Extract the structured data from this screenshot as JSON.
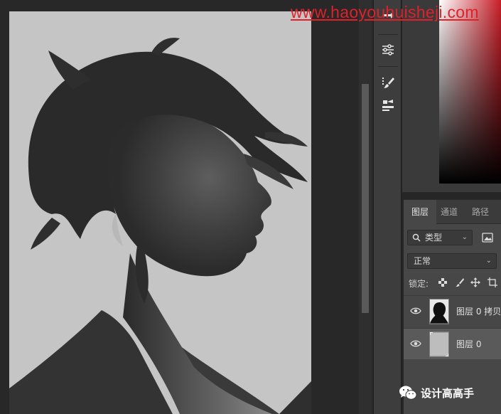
{
  "colors": {
    "canvas_bg": "#c5c5c5",
    "panel_bg": "#474747",
    "toolbar_bg": "#3d3d3d",
    "watermark": "#e0202a",
    "selected_layer": "#5a5a5a"
  },
  "toolbar": {
    "tools": [
      {
        "icon": "history-brush-icon"
      },
      {
        "icon": "adjustments-sliders-icon"
      },
      {
        "icon": "brush-settings-icon"
      },
      {
        "icon": "tool-presets-icon"
      }
    ]
  },
  "layers_panel": {
    "tabs": [
      {
        "label": "图层",
        "active": true
      },
      {
        "label": "通道",
        "active": false
      },
      {
        "label": "路径",
        "active": false
      }
    ],
    "filter": {
      "value": "类型",
      "icon": "search-icon"
    },
    "blend_mode": {
      "value": "正常"
    },
    "lock": {
      "label": "锁定:"
    },
    "layers": [
      {
        "name": "图层 0 拷贝",
        "visible": true,
        "selected": false,
        "thumbnail": "silhouette-thumbnail"
      },
      {
        "name": "图层 0",
        "visible": true,
        "selected": true,
        "thumbnail": "gray-thumbnail"
      }
    ]
  },
  "watermarks": {
    "url": "www.haoyouhuisheji.com",
    "wechat": "设计高高手"
  }
}
